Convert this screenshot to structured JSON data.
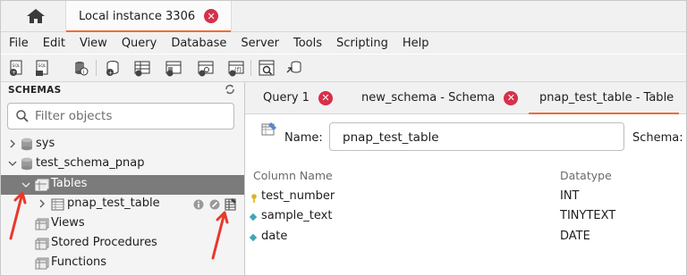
{
  "top_tabs": {
    "connection_tab_label": "Local instance 3306"
  },
  "menu": [
    "File",
    "Edit",
    "View",
    "Query",
    "Database",
    "Server",
    "Tools",
    "Scripting",
    "Help"
  ],
  "navigator": {
    "header": "SCHEMAS",
    "filter_placeholder": "Filter objects",
    "tree": {
      "schema_sys": "sys",
      "schema_test": "test_schema_pnap",
      "tables": "Tables",
      "table_item": "pnap_test_table",
      "views": "Views",
      "stored_procedures": "Stored Procedures",
      "functions": "Functions"
    }
  },
  "editor_tabs": [
    "Query 1",
    "new_schema - Schema",
    "pnap_test_table - Table"
  ],
  "table_editor": {
    "name_label": "Name:",
    "name_value": "pnap_test_table",
    "schema_label": "Schema:",
    "column_header_name": "Column Name",
    "column_header_type": "Datatype",
    "columns": [
      {
        "name": "test_number",
        "type": "INT",
        "icon": "primary-key-icon"
      },
      {
        "name": "sample_text",
        "type": "TINYTEXT",
        "icon": "column-diamond-icon"
      },
      {
        "name": "date",
        "type": "DATE",
        "icon": "column-diamond-icon"
      }
    ]
  },
  "colors": {
    "accent_orange": "#f16b36",
    "close_red": "#d6304a",
    "annotation_red": "#e8392b",
    "selection_gray": "#7b7b7b"
  }
}
